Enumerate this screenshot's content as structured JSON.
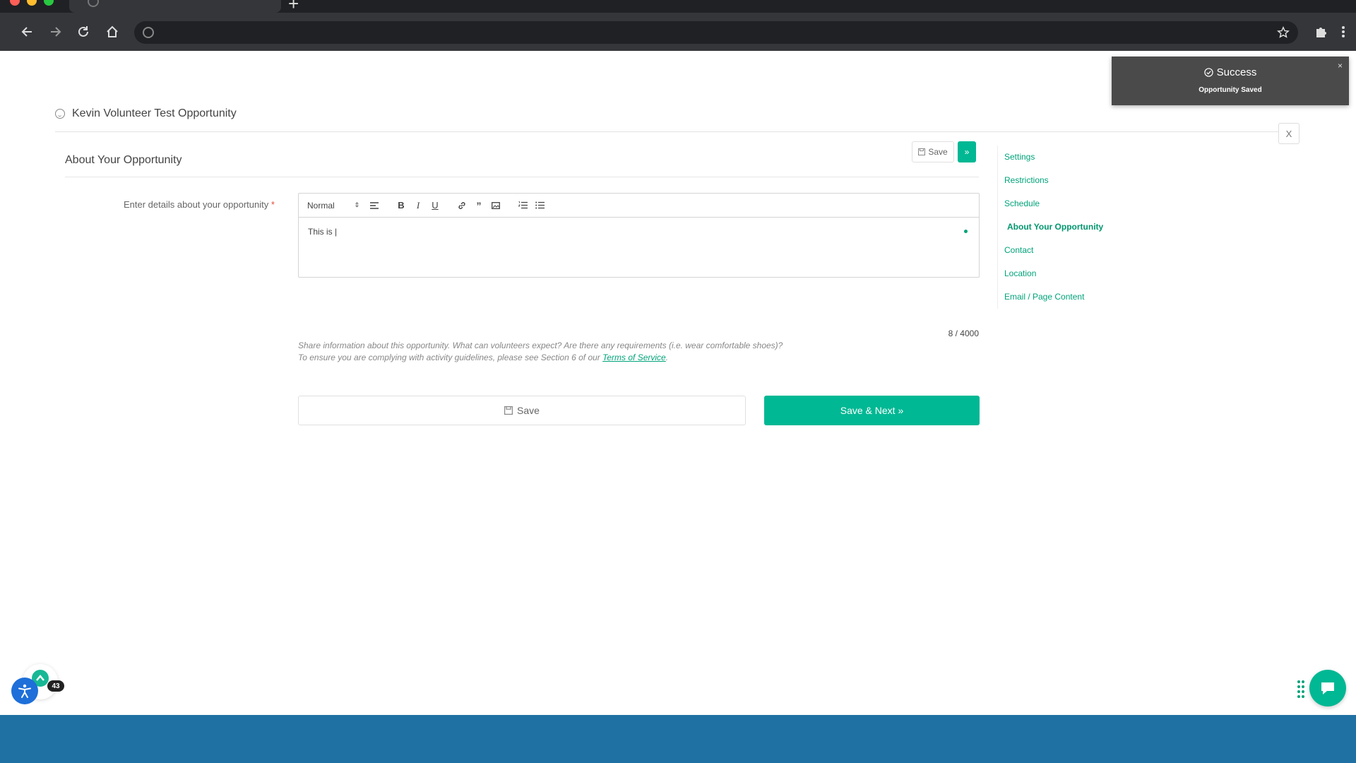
{
  "page": {
    "title": "Kevin Volunteer Test Opportunity",
    "close_label": "X"
  },
  "section": {
    "title": "About Your Opportunity",
    "save_label": "Save",
    "next_label": "»"
  },
  "form": {
    "field_label": "Enter details about your opportunity",
    "required_mark": "*",
    "format_value": "Normal",
    "editor_text": "This is |",
    "char_count": "8 / 4000",
    "help_line1": "Share information about this opportunity. What can volunteers expect? Are there any requirements (i.e. wear comfortable shoes)?",
    "help_line2_prefix": "To ensure you are complying with activity guidelines, please see Section 6 of our ",
    "help_link": "Terms of Service",
    "help_line2_suffix": "."
  },
  "actions": {
    "save_label": "Save",
    "save_next_label": "Save & Next »"
  },
  "side_nav": {
    "items": [
      {
        "label": "Settings"
      },
      {
        "label": "Restrictions"
      },
      {
        "label": "Schedule"
      },
      {
        "label": "About Your Opportunity"
      },
      {
        "label": "Contact"
      },
      {
        "label": "Location"
      },
      {
        "label": "Email / Page Content"
      }
    ],
    "active_index": 3
  },
  "toast": {
    "title": "Success",
    "message": "Opportunity Saved",
    "close_label": "×"
  },
  "widgets": {
    "badge_count": "43"
  },
  "colors": {
    "accent": "#00b894",
    "link": "#00a37a",
    "footer": "#2071a3",
    "toast_bg": "#4a4a4a",
    "accessibility": "#1e6fd9"
  }
}
